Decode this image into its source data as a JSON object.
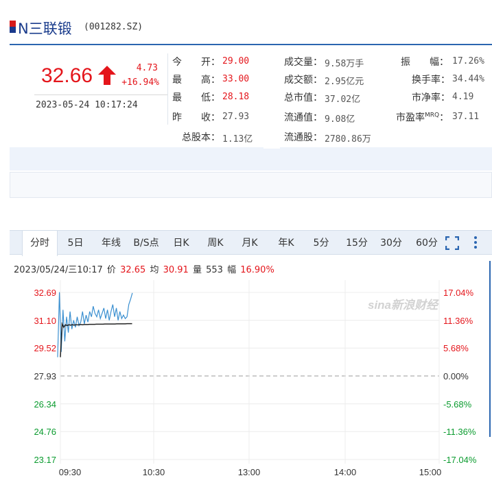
{
  "header": {
    "name": "N三联锻",
    "code": "(001282.SZ)"
  },
  "price": {
    "current": "32.66",
    "change": "4.73",
    "change_pct": "+16.94%",
    "datetime": "2023-05-24 10:17:24"
  },
  "quotes": {
    "open_label": "今　　开：",
    "open": "29.00",
    "high_label": "最　　高：",
    "high": "33.00",
    "low_label": "最　　低：",
    "low": "28.18",
    "prev_label": "昨　　收：",
    "prev": "27.93",
    "total_shares_label": "总股本：",
    "total_shares": "1.13亿",
    "volume_label": "成交量：",
    "volume": "9.58万手",
    "amount_label": "成交额：",
    "amount": "2.95亿元",
    "mkt_cap_label": "总市值：",
    "mkt_cap": "37.02亿",
    "float_cap_label": "流通值：",
    "float_cap": "9.08亿",
    "float_shares_label": "流通股：",
    "float_shares": "2780.86万",
    "amplitude_label": "振　　幅：",
    "amplitude": "17.26%",
    "turnover_label": "换手率：",
    "turnover": "34.44%",
    "pb_label": "市净率：",
    "pb": "4.19",
    "pe_label": "市盈率",
    "pe_sup": "MRQ",
    "pe_colon": "：",
    "pe": "37.11"
  },
  "tabs": [
    "分时",
    "5日",
    "年线",
    "B/S点",
    "日K",
    "周K",
    "月K",
    "年K",
    "5分",
    "15分",
    "30分",
    "60分"
  ],
  "active_tab": "分时",
  "chart_info": {
    "datetime": "2023/05/24/三10:17",
    "price_label": "价",
    "price": "32.65",
    "avg_label": "均",
    "avg": "30.91",
    "vol_label": "量",
    "vol": "553",
    "amp_label": "幅",
    "amp": "16.90%"
  },
  "watermark": "sina新浪财经",
  "colors": {
    "up": "#e4151b",
    "down": "#0a9b2e",
    "price_line": "#3a8fd0",
    "avg_line": "#222222",
    "accent": "#2a65b0"
  },
  "chart_data": {
    "type": "line",
    "title": "",
    "xlabel": "",
    "ylabel": "",
    "x_ticks": [
      "09:30",
      "10:30",
      "13:00",
      "14:00",
      "15:00"
    ],
    "y_ticks_left": [
      "32.69",
      "31.10",
      "29.52",
      "27.93",
      "26.34",
      "24.76",
      "23.17"
    ],
    "y_ticks_right": [
      "17.04%",
      "11.36%",
      "5.68%",
      "0.00%",
      "-5.68%",
      "-11.36%",
      "-17.04%"
    ],
    "ylim": [
      23.17,
      32.69
    ],
    "reference": 27.93,
    "series": [
      {
        "values": [
          29.0,
          32.7,
          29.3,
          31.7,
          29.9,
          31.3,
          30.4,
          31.6,
          30.6,
          31.1,
          30.7,
          31.3,
          30.8,
          31.0,
          31.6,
          30.9,
          31.4,
          31.0,
          31.6,
          31.3,
          31.9,
          31.5,
          31.3,
          31.7,
          31.2,
          31.5,
          31.8,
          31.2,
          31.7,
          31.1,
          31.6,
          32.0,
          31.3,
          31.8,
          31.1,
          31.6,
          31.2,
          31.4,
          31.2,
          31.3,
          32.0,
          32.3,
          32.66
        ]
      },
      {
        "values": [
          29.0,
          30.9,
          30.7,
          30.85,
          30.8,
          30.85,
          30.82,
          30.85,
          30.83,
          30.85,
          30.84,
          30.85,
          30.86,
          30.85,
          30.86,
          30.86,
          30.86,
          30.87,
          30.87,
          30.87,
          30.87,
          30.88,
          30.88,
          30.88,
          30.88,
          30.88,
          30.89,
          30.89,
          30.89,
          30.89,
          30.89,
          30.89,
          30.89,
          30.9,
          30.9,
          30.9,
          30.9,
          30.9,
          30.9,
          30.91,
          30.91,
          30.91,
          30.91
        ]
      }
    ],
    "grid": true
  }
}
